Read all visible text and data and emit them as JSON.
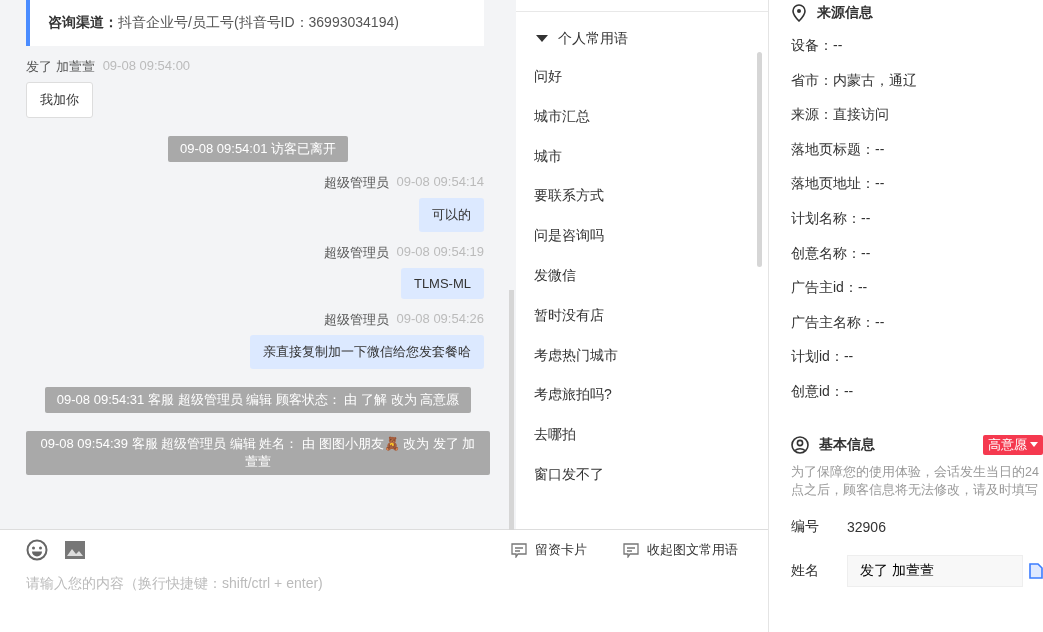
{
  "chat": {
    "info_card": {
      "label": "咨询渠道：",
      "value": "抖音企业号/员工号(抖音号ID：36993034194)"
    },
    "messages": [
      {
        "kind": "customer",
        "sender": "发了 加萱萱",
        "time": "09-08 09:54:00",
        "text": "我加你"
      },
      {
        "kind": "system",
        "text": "09-08 09:54:01 访客已离开"
      },
      {
        "kind": "agent",
        "sender": "超级管理员",
        "time": "09-08 09:54:14",
        "text": "可以的"
      },
      {
        "kind": "agent",
        "sender": "超级管理员",
        "time": "09-08 09:54:19",
        "text": "TLMS-ML"
      },
      {
        "kind": "agent",
        "sender": "超级管理员",
        "time": "09-08 09:54:26",
        "text": "亲直接复制加一下微信给您发套餐哈"
      },
      {
        "kind": "log",
        "text": "09-08 09:54:31 客服 超级管理员 编辑 顾客状态： 由 了解 改为 高意愿"
      },
      {
        "kind": "log",
        "text": "09-08 09:54:39 客服 超级管理员 编辑 姓名： 由 图图小朋友🧸 改为 发了 加萱萱"
      }
    ]
  },
  "phrases": {
    "group": {
      "title": "个人常用语",
      "expanded": true
    },
    "items": [
      "问好",
      "城市汇总",
      "城市",
      "要联系方式",
      "问是咨询吗",
      "发微信",
      "暂时没有店",
      "考虑热门城市",
      "考虑旅拍吗?",
      "去哪拍",
      "窗口发不了"
    ]
  },
  "composer": {
    "actions": [
      "留资卡片",
      "收起图文常用语"
    ],
    "placeholder": "请输入您的内容（换行快捷键：shift/ctrl + enter)"
  },
  "source_info": {
    "title": "来源信息",
    "fields": [
      "设备：--",
      "省市：内蒙古，通辽",
      "来源：直接访问",
      "落地页标题：--",
      "落地页地址：--",
      "计划名称：--",
      "创意名称：--",
      "广告主id：--",
      "广告主名称：--",
      "计划id：--",
      "创意id：--"
    ]
  },
  "basic_info": {
    "title": "基本信息",
    "status": "高意愿",
    "notice": "为了保障您的使用体验，会话发生当日的24点之后，顾客信息将无法修改，请及时填写",
    "fields": [
      {
        "kind": "text",
        "label": "编号",
        "value": "32906"
      },
      {
        "kind": "input",
        "label": "姓名",
        "value": "发了 加萱萱"
      }
    ]
  }
}
